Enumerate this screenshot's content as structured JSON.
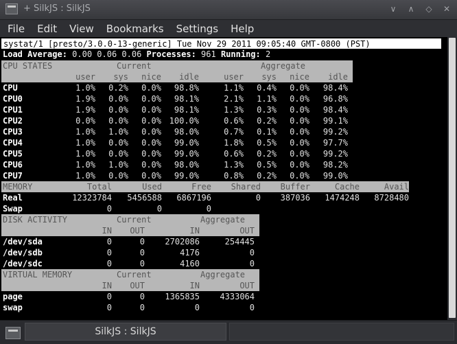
{
  "window": {
    "title": "+ SilkJS : SilkJS",
    "icon": "terminal-icon"
  },
  "window_buttons": [
    "∨",
    "∧",
    "◇",
    "✕"
  ],
  "menu": [
    "File",
    "Edit",
    "View",
    "Bookmarks",
    "Settings",
    "Help"
  ],
  "status": "systat/1 [presto/3.0.0-13-generic] Tue Nov 29 2011 09:05:40 GMT-0800 (PST)",
  "load": {
    "label": "Load Average:",
    "values": "0.00 0.06 0.06",
    "proc_label": "Processes:",
    "proc": "961",
    "run_label": "Running:",
    "run": "2"
  },
  "cpu": {
    "title": "CPU STATES",
    "current": "Current",
    "aggregate": "Aggregate",
    "cols": [
      "user",
      "sys",
      "nice",
      "idle",
      "user",
      "sys",
      "nice",
      "idle"
    ],
    "rows": [
      {
        "name": "CPU",
        "vals": [
          "1.0%",
          "0.2%",
          "0.0%",
          "98.8%",
          "1.1%",
          "0.4%",
          "0.0%",
          "98.4%"
        ]
      },
      {
        "name": "CPU0",
        "vals": [
          "1.9%",
          "0.0%",
          "0.0%",
          "98.1%",
          "2.1%",
          "1.1%",
          "0.0%",
          "96.8%"
        ]
      },
      {
        "name": "CPU1",
        "vals": [
          "1.9%",
          "0.0%",
          "0.0%",
          "98.1%",
          "1.3%",
          "0.3%",
          "0.0%",
          "98.4%"
        ]
      },
      {
        "name": "CPU2",
        "vals": [
          "0.0%",
          "0.0%",
          "0.0%",
          "100.0%",
          "0.6%",
          "0.2%",
          "0.0%",
          "99.1%"
        ]
      },
      {
        "name": "CPU3",
        "vals": [
          "1.0%",
          "1.0%",
          "0.0%",
          "98.0%",
          "0.7%",
          "0.1%",
          "0.0%",
          "99.2%"
        ]
      },
      {
        "name": "CPU4",
        "vals": [
          "1.0%",
          "0.0%",
          "0.0%",
          "99.0%",
          "1.8%",
          "0.5%",
          "0.0%",
          "97.7%"
        ]
      },
      {
        "name": "CPU5",
        "vals": [
          "1.0%",
          "0.0%",
          "0.0%",
          "99.0%",
          "0.6%",
          "0.2%",
          "0.0%",
          "99.2%"
        ]
      },
      {
        "name": "CPU6",
        "vals": [
          "1.0%",
          "1.0%",
          "0.0%",
          "98.0%",
          "1.3%",
          "0.5%",
          "0.0%",
          "98.2%"
        ]
      },
      {
        "name": "CPU7",
        "vals": [
          "1.0%",
          "0.0%",
          "0.0%",
          "99.0%",
          "0.8%",
          "0.2%",
          "0.0%",
          "99.0%"
        ]
      }
    ]
  },
  "memory": {
    "title": "MEMORY",
    "cols": [
      "Total",
      "Used",
      "Free",
      "Shared",
      "Buffer",
      "Cache",
      "Avail"
    ],
    "rows": [
      {
        "name": "Real",
        "vals": [
          "12323784",
          "5456588",
          "6867196",
          "0",
          "387036",
          "1474248",
          "8728480"
        ]
      },
      {
        "name": "Swap",
        "vals": [
          "0",
          "0",
          "0",
          "",
          "",
          "",
          ""
        ]
      }
    ]
  },
  "disk": {
    "title": "DISK ACTIVITY",
    "current": "Current",
    "aggregate": "Aggregate",
    "cols": [
      "IN",
      "OUT",
      "IN",
      "OUT"
    ],
    "rows": [
      {
        "name": "/dev/sda",
        "vals": [
          "0",
          "0",
          "2702086",
          "254445"
        ]
      },
      {
        "name": "/dev/sdb",
        "vals": [
          "0",
          "0",
          "4176",
          "0"
        ]
      },
      {
        "name": "/dev/sdc",
        "vals": [
          "0",
          "0",
          "4160",
          "0"
        ]
      }
    ]
  },
  "vm": {
    "title": "VIRTUAL MEMORY",
    "current": "Current",
    "aggregate": "Aggregate",
    "cols": [
      "IN",
      "OUT",
      "IN",
      "OUT"
    ],
    "rows": [
      {
        "name": "page",
        "vals": [
          "0",
          "0",
          "1365835",
          "4333064"
        ]
      },
      {
        "name": "swap",
        "vals": [
          "0",
          "0",
          "0",
          "0"
        ]
      }
    ]
  },
  "taskbar": {
    "task_label": "SilkJS : SilkJS"
  }
}
